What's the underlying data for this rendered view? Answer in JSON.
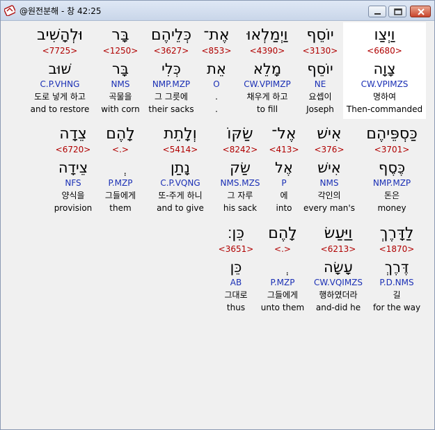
{
  "window": {
    "title": "@원전분해 - 창 42:25"
  },
  "rows": [
    [
      {
        "heb": "וַיְצַו",
        "strong": "<6680>",
        "root": "צָוָה",
        "parse": "CW.VPIMZS",
        "kor": "명하여",
        "eng": "Then-commanded"
      },
      {
        "heb": "יוֹסֵף",
        "strong": "<3130>",
        "root": "יוֹסֵף",
        "parse": "NE",
        "kor": "요셉이",
        "eng": "Joseph"
      },
      {
        "heb": "וַיְמַלְאוּ",
        "strong": "<4390>",
        "root": "מָלֵא",
        "parse": "CW.VPIMZP",
        "kor": "채우게 하고",
        "eng": "to fill"
      },
      {
        "heb": "אֶת־",
        "strong": "<853>",
        "root": "אֵת",
        "parse": "O",
        "kor": ".",
        "eng": "."
      },
      {
        "heb": "כְּלֵיהֶם",
        "strong": "<3627>",
        "root": "כְּלִי",
        "parse": "NMP.MZP",
        "kor": "그 그릇에",
        "eng": "their sacks"
      },
      {
        "heb": "בָּר",
        "strong": "<1250>",
        "root": "בָּר",
        "parse": "NMS",
        "kor": "곡물을",
        "eng": "with corn"
      },
      {
        "heb": "וּלְהָשִׁיב",
        "strong": "<7725>",
        "root": "שׁוּב",
        "parse": "C.P.VHNG",
        "kor": "도로 넣게 하고",
        "eng": "and to restore"
      }
    ],
    [
      {
        "heb": "כַּסְפֵּיהֶם",
        "strong": "<3701>",
        "root": "כֶּסֶף",
        "parse": "NMP.MZP",
        "kor": "돈은",
        "eng": "money"
      },
      {
        "heb": "אִישׁ",
        "strong": "<376>",
        "root": "אִישׁ",
        "parse": "NMS",
        "kor": "각인의",
        "eng": "every man's"
      },
      {
        "heb": "אֶל־",
        "strong": "<413>",
        "root": "אֶל",
        "parse": "P",
        "kor": "에",
        "eng": "into"
      },
      {
        "heb": "שַׂקּוֹ",
        "strong": "<8242>",
        "root": "שַׂק",
        "parse": "NMS.MZS",
        "kor": "그 자루",
        "eng": "his sack"
      },
      {
        "heb": "וְלָתֵת",
        "strong": "<5414>",
        "root": "נָתַן",
        "parse": "C.P.VQNG",
        "kor": "또-주게 하니",
        "eng": "and to give"
      },
      {
        "heb": "לָהֶם",
        "strong": "<.>",
        "root": "ְ",
        "parse": "P.MZP",
        "kor": "그들에게",
        "eng": "them"
      },
      {
        "heb": "צֵדָה",
        "strong": "<6720>",
        "root": "צֵידָה",
        "parse": "NFS",
        "kor": "양식을",
        "eng": "provision"
      }
    ],
    [
      {
        "heb": "לַדָּרֶךְ",
        "strong": "<1870>",
        "root": "דֶּרֶךְ",
        "parse": "P.D.NMS",
        "kor": "길",
        "eng": "for the way"
      },
      {
        "heb": "וַיַּעַשׂ",
        "strong": "<6213>",
        "root": "עָשָׂה",
        "parse": "CW.VQIMZS",
        "kor": "행하였더라",
        "eng": "and-did he"
      },
      {
        "heb": "לָהֶם",
        "strong": "<.>",
        "root": "ְ",
        "parse": "P.MZP",
        "kor": "그들에게",
        "eng": "unto them"
      },
      {
        "heb": "כֵּן׃",
        "strong": "<3651>",
        "root": "כֵּן",
        "parse": "AB",
        "kor": "그대로",
        "eng": "thus"
      }
    ]
  ]
}
